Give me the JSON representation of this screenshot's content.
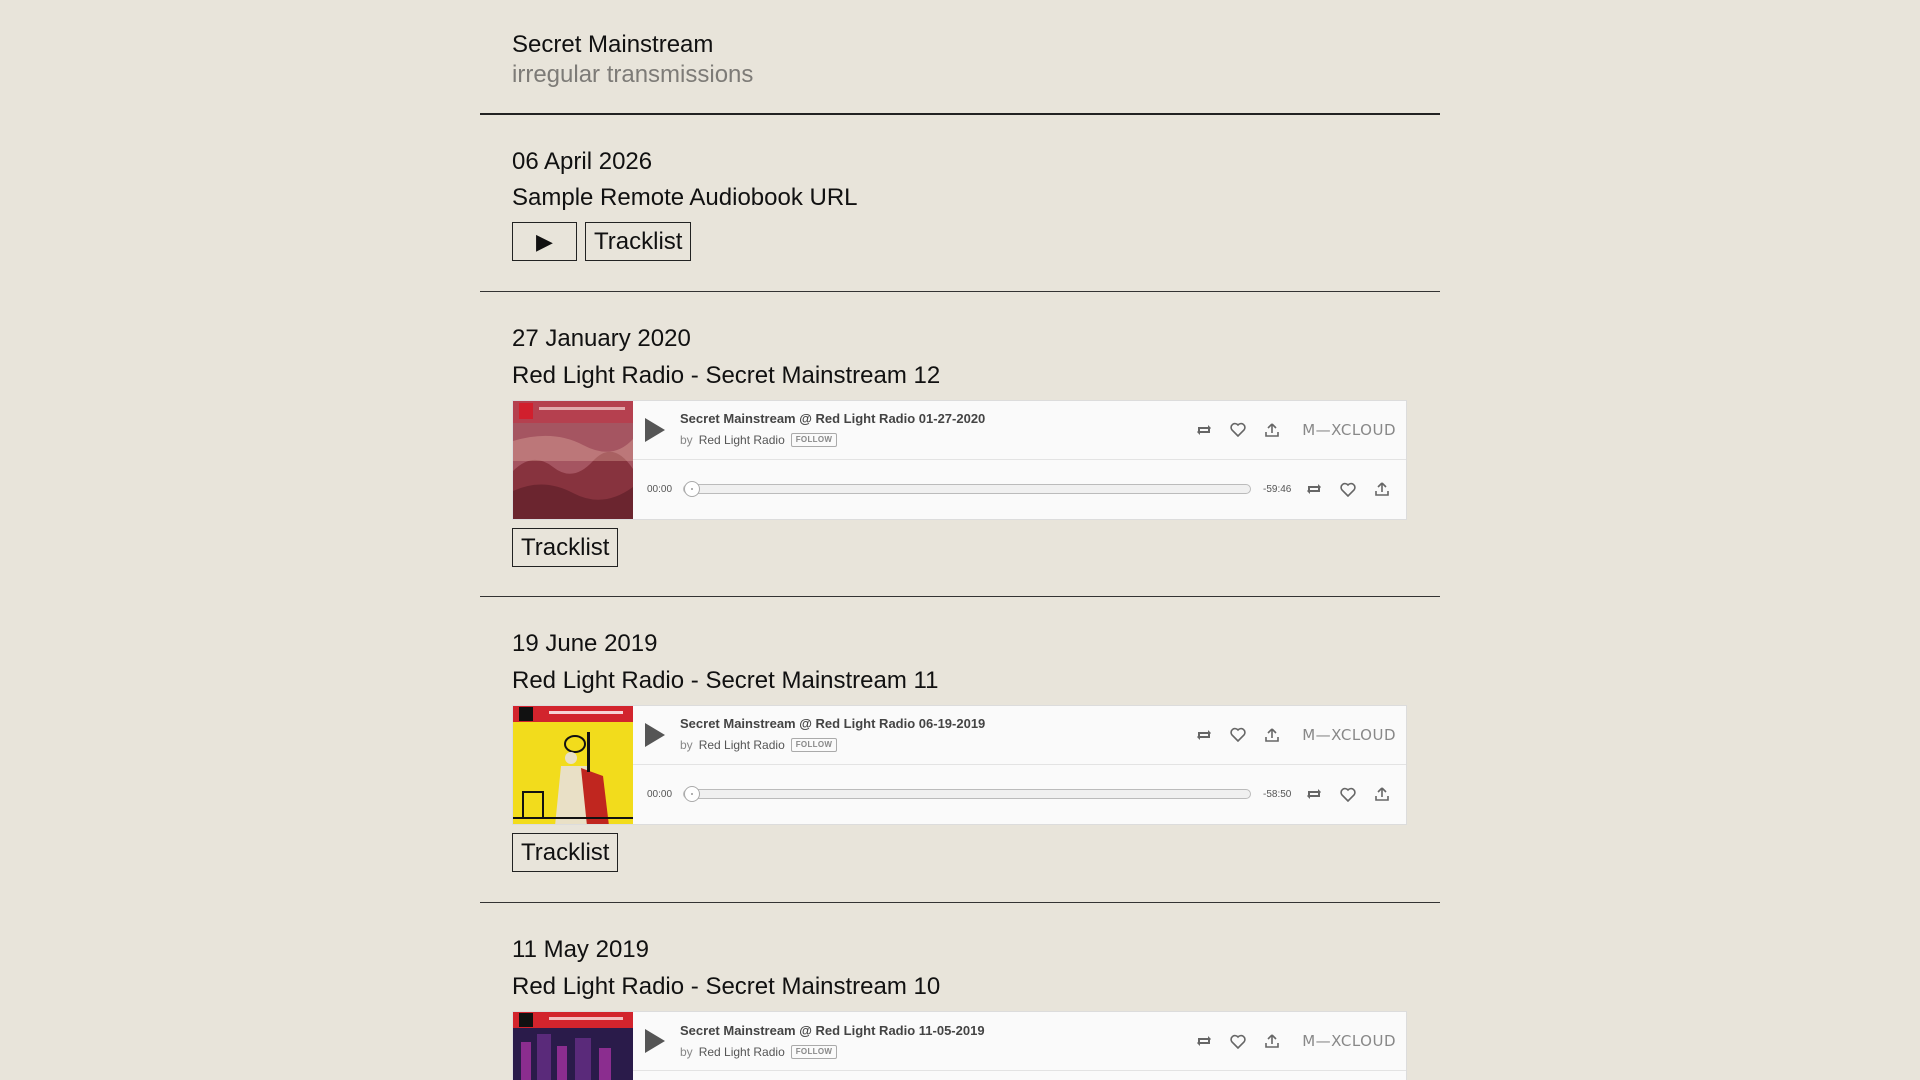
{
  "site": {
    "title": "Secret Mainstream",
    "subtitle": "irregular transmissions"
  },
  "posts": [
    {
      "date": "06 April 2026",
      "title": "Sample Remote Audiobook URL",
      "play_label": "▶",
      "tracklist_label": "Tracklist"
    },
    {
      "date": "27 January 2020",
      "title": "Red Light Radio - Secret Mainstream 12",
      "tracklist_label": "Tracklist",
      "embed": {
        "show_title": "Secret Mainstream @ Red Light Radio 01-27-2020",
        "by": "by",
        "artist": "Red Light Radio",
        "follow": "FOLLOW",
        "elapsed": "00:00",
        "remaining": "-59:46",
        "progress": 0,
        "logo": "M—XCLOUD",
        "artwork_colors": [
          "#b5404f",
          "#e8b7a6",
          "#7f2a36"
        ]
      }
    },
    {
      "date": "19 June 2019",
      "title": "Red Light Radio - Secret Mainstream 11",
      "tracklist_label": "Tracklist",
      "embed": {
        "show_title": "Secret Mainstream @ Red Light Radio 06-19-2019",
        "by": "by",
        "artist": "Red Light Radio",
        "follow": "FOLLOW",
        "elapsed": "00:00",
        "remaining": "-58:50",
        "progress": 0,
        "logo": "M—XCLOUD",
        "artwork_colors": [
          "#f2dc1c",
          "#c0261f",
          "#e9e0c6"
        ]
      }
    },
    {
      "date": "11 May 2019",
      "title": "Red Light Radio - Secret Mainstream 10",
      "embed": {
        "show_title": "Secret Mainstream @ Red Light Radio 11-05-2019",
        "by": "by",
        "artist": "Red Light Radio",
        "follow": "FOLLOW",
        "logo": "M—XCLOUD",
        "artwork_colors": [
          "#2a1b4a",
          "#d2242d",
          "#8b2d8f"
        ]
      }
    }
  ]
}
